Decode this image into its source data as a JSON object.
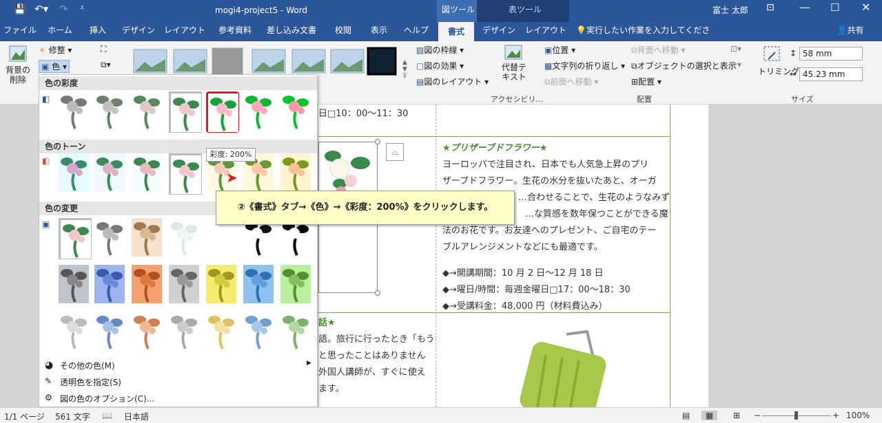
{
  "app": {
    "title": "mogi4-project5 - Word",
    "user": "富士 太郎"
  },
  "context_tabs": {
    "picture_tools": "図ツール",
    "table_tools": "表ツール"
  },
  "tabs": [
    "ファイル",
    "ホーム",
    "挿入",
    "デザイン",
    "レイアウト",
    "参考資料",
    "差し込み文書",
    "校閲",
    "表示",
    "ヘルプ",
    "書式",
    "デザイン",
    "レイアウト"
  ],
  "tellme": "実行したい作業を入力してください",
  "share": "共有",
  "ribbon": {
    "remove_bg": "背景の削除",
    "corrections": "修整",
    "color": "色",
    "picture_border": "図の枠線",
    "picture_effects": "図の効果",
    "picture_layout": "図のレイアウト",
    "alt_text": "代替テキスト",
    "accessibility": "アクセシビリ…",
    "position": "位置",
    "wrap_text": "文字列の折り返し",
    "bring_forward": "前面へ移動",
    "send_backward": "背面へ移動",
    "selection_pane": "オブジェクトの選択と表示",
    "align": "配置",
    "arrange_label": "配置",
    "crop": "トリミング",
    "height": "58 mm",
    "width": "45.23 mm",
    "size_label": "サイズ"
  },
  "gallery": {
    "saturation_header": "色の彩度",
    "tone_header": "色のトーン",
    "recolor_header": "色の変更",
    "more_colors": "その他の色(M)",
    "set_transparent": "透明色を指定(S)",
    "color_options": "図の色のオプション(C)..."
  },
  "tooltip": "彩度: 200%",
  "callout": "②《書式》タブ→《色》→《彩度：200%》をクリックします。",
  "doc": {
    "line_top": "日□10：00〜11：30",
    "heading": "★プリザーブドフラワー★",
    "para": [
      "ヨーロッパで注目され、日本でも人気急上昇のプリ",
      "ザーブドフラワー。生花の水分を抜いたあと、オーガ",
      "…合わせることで、生花のようなみず",
      "…な質感を数年保つことができる魔",
      "法のお花です。お友達へのプレゼント、ご自宅のテー",
      "ブルアレンジメントなどにも最適です。"
    ],
    "items": [
      "◆→開講期間：10 月 2 日〜12 月 18 日",
      "◆→曜日/時間：毎週金曜日□17：00〜18：30",
      "◆→受講料金：48,000 円（材料費込み）"
    ],
    "heading2": "話★",
    "left2": [
      "語。旅行に行ったとき「もう",
      "と思ったことはありません",
      "外国人講師が、すぐに使え",
      "ます。"
    ]
  },
  "status": {
    "page": "1/1 ページ",
    "words": "561 文字",
    "lang": "日本語",
    "zoom": "100%"
  },
  "colors": {
    "word_blue": "#2b579a",
    "highlight": "#e8161b",
    "callout_bg": "#ffffc8"
  }
}
